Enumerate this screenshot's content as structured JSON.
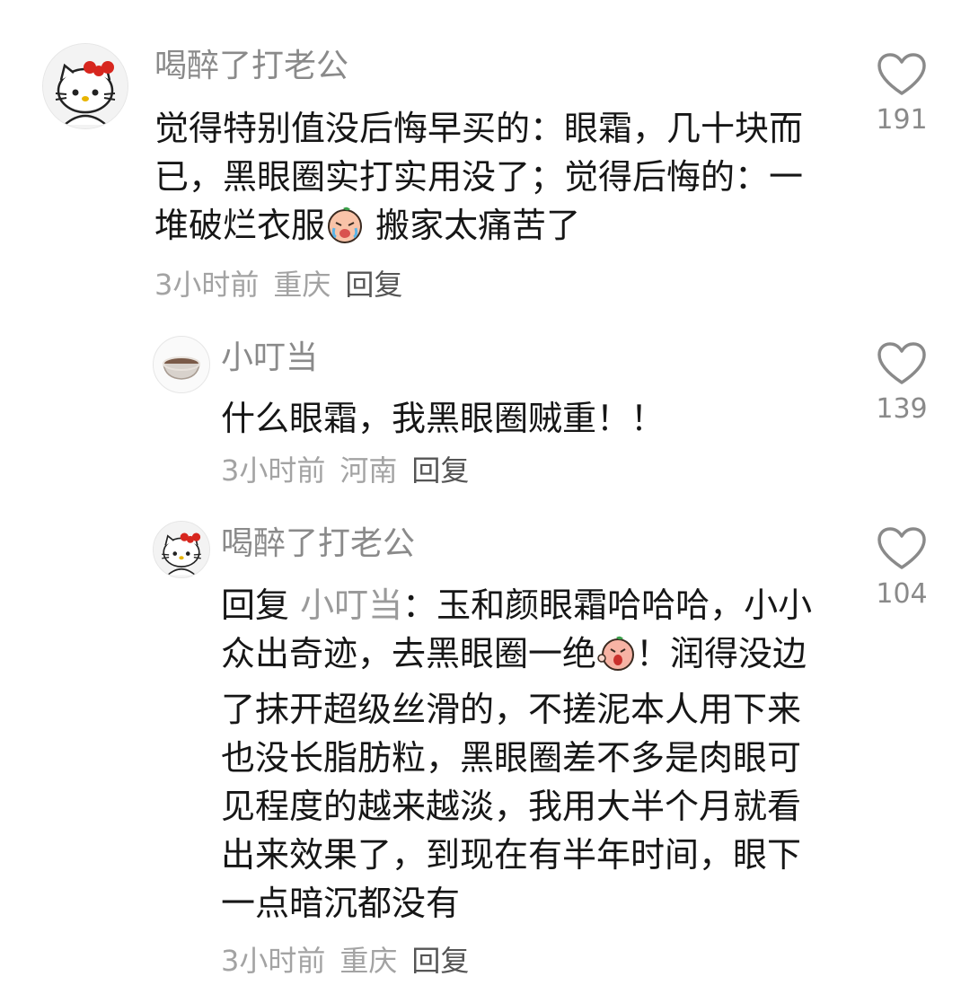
{
  "comments": [
    {
      "username": "喝醉了打老公",
      "avatar_icon": "hello-kitty-avatar-icon",
      "text_part1": "觉得特别值没后悔早买的：眼霜，几十块而已，黑眼圈实打实用没了；觉得后悔的：一堆破烂衣服",
      "emoji_icon": "crying-peach-emoji-icon",
      "text_part2": " 搬家太痛苦了",
      "time": "3小时前",
      "location": "重庆",
      "reply_label": "回复",
      "likes": "191"
    },
    {
      "username": "小叮当",
      "avatar_icon": "bowl-avatar-icon",
      "text": "什么眼霜，我黑眼圈贼重！！",
      "time": "3小时前",
      "location": "河南",
      "reply_label": "回复",
      "likes": "139"
    },
    {
      "username": "喝醉了打老公",
      "avatar_icon": "hello-kitty-avatar-icon",
      "reply_prefix": "回复 ",
      "mention": "小叮当",
      "text_part1": "：玉和颜眼霜哈哈哈，小小众出奇迹，去黑眼圈一绝",
      "emoji_icon": "shouting-peach-emoji-icon",
      "text_part2": "！润得没边了抹开超级丝滑的，不搓泥本人用下来也没长脂肪粒，黑眼圈差不多是肉眼可见程度的越来越淡，我用大半个月就看出来效果了，到现在有半年时间，眼下一点暗沉都没有",
      "time": "3小时前",
      "location": "重庆",
      "reply_label": "回复",
      "likes": "104"
    }
  ],
  "colors": {
    "username": "#8a8a8a",
    "body": "#161616",
    "meta": "#a3a3a3",
    "reply": "#555555",
    "heart": "#8a8a8a"
  }
}
